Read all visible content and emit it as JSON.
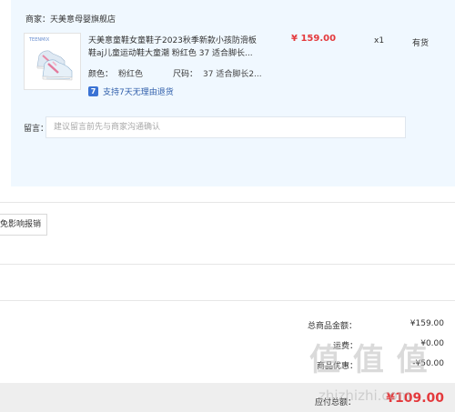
{
  "shop": {
    "label": "商家：",
    "name": "天美意母婴旗舰店"
  },
  "product": {
    "thumb_brand": "TEENMIX",
    "title": "天美意童鞋女童鞋子2023秋季新款小孩防滑板鞋aj儿童运动鞋大童潮 粉红色 37 适合脚长...",
    "price": "¥ 159.00",
    "qty": "x1",
    "stock": "有货",
    "color_key": "颜色：",
    "color_value": "粉红色",
    "size_key": "尺码：",
    "size_value": "37 适合脚长2...",
    "return_icon": "7",
    "return_text": "支持7天无理由退货"
  },
  "message": {
    "label": "留言：",
    "placeholder": "建议留言前先与商家沟通确认"
  },
  "report_button": "免影响报销",
  "summary": [
    {
      "label": "总商品金额：",
      "value": "¥159.00"
    },
    {
      "label": "运费：",
      "value": "¥0.00"
    },
    {
      "label": "商品优惠：",
      "value": "-¥50.00"
    }
  ],
  "payable": {
    "label": "应付总额：",
    "value": "¥109.00"
  },
  "watermark": {
    "text": "值 值 值",
    "url": "zhizhizhi.com"
  },
  "colors": {
    "price_red": "#e4393c",
    "panel_bg": "#f0f8ff",
    "link_blue": "#2f5eaa"
  }
}
